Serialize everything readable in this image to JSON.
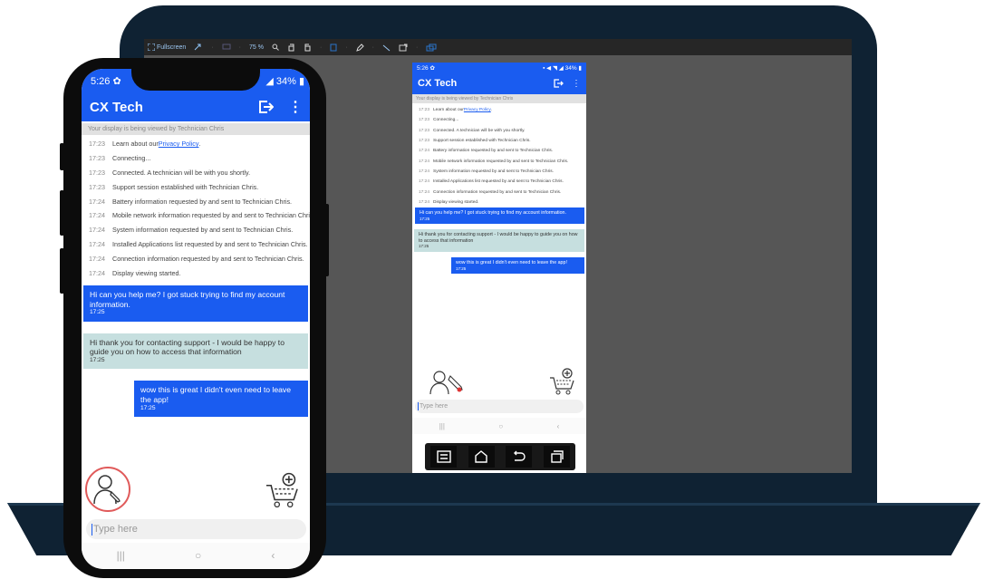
{
  "toolbar": {
    "fullscreen_label": "Fullscreen",
    "zoom_label": "75 %"
  },
  "device": {
    "status_time": "5:26",
    "status_battery": "34%",
    "app_title": "CX Tech",
    "banner": "Your display is being viewed by Technician Chris",
    "log": [
      {
        "time": "17:23",
        "text": "Learn about our ",
        "link": "Privacy Policy",
        "suffix": "."
      },
      {
        "time": "17:23",
        "text": "Connecting..."
      },
      {
        "time": "17:23",
        "text": "Connected. A technician will be with you shortly."
      },
      {
        "time": "17:23",
        "text": "Support session established with Technician Chris."
      },
      {
        "time": "17:24",
        "text": "Battery information requested by and sent to Technician Chris."
      },
      {
        "time": "17:24",
        "text": "Mobile network information requested by and sent to Technician Chris."
      },
      {
        "time": "17:24",
        "text": "System information requested by and sent to Technician Chris."
      },
      {
        "time": "17:24",
        "text": "Installed Applications list requested by and sent to Technician Chris."
      },
      {
        "time": "17:24",
        "text": "Connection information requested by and sent to Technician Chris."
      },
      {
        "time": "17:24",
        "text": "Display viewing started."
      }
    ],
    "messages": [
      {
        "from": "user",
        "text": "Hi can you help me? I got stuck trying to find my account information.",
        "time": "17:25"
      },
      {
        "from": "agent",
        "text": "Hi thank you for contacting support - I would be happy to guide you on how to access that information",
        "time": "17:25"
      },
      {
        "from": "user",
        "text": "wow this is great I didn't even need to leave the app!",
        "time": "17:25"
      }
    ],
    "input_placeholder": "Type here"
  },
  "colors": {
    "brand_blue": "#1a5cf0",
    "agent_bubble": "#c6dfdf",
    "laptop_frame": "#0f2233",
    "highlight": "#e05a5a"
  },
  "icons": {
    "exit": "exit-icon",
    "menu": "more-vert-icon",
    "technician": "technician-icon",
    "cart": "cart-add-icon"
  }
}
